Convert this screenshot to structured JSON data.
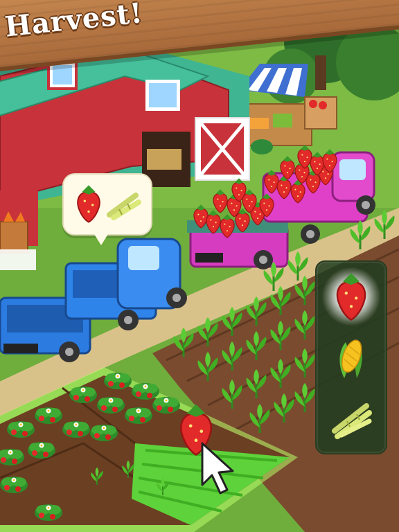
{
  "banner": {
    "title": "Harvest!"
  },
  "crop_panel": {
    "items": [
      {
        "name": "strawberry-icon",
        "selected": true
      },
      {
        "name": "corn-icon",
        "selected": false
      },
      {
        "name": "sugarcane-icon",
        "selected": false
      }
    ]
  },
  "order_bubble": {
    "items": [
      "strawberry-icon",
      "sugarcane-icon"
    ]
  },
  "colors": {
    "barn_red": "#c8323a",
    "barn_roof": "#3fb592",
    "truck_blue": "#2c7be0",
    "truck_pink": "#e040c8",
    "strawberry": "#e22a2a",
    "soil": "#7a4b2e",
    "grass": "#6fae3c",
    "selection_glow": "#b8ff6a"
  }
}
